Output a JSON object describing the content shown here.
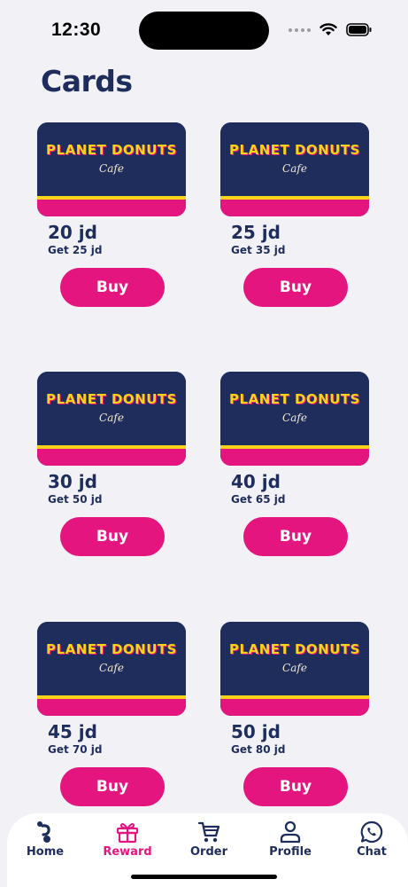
{
  "status_bar": {
    "time": "12:30"
  },
  "page": {
    "title": "Cards"
  },
  "card_logo": {
    "line1": "PLANET DONUTS",
    "line2": "Cafe"
  },
  "cards": [
    {
      "price": "20 jd",
      "bonus": "Get 25 jd",
      "buy_label": "Buy"
    },
    {
      "price": "25 jd",
      "bonus": "Get 35 jd",
      "buy_label": "Buy"
    },
    {
      "price": "30 jd",
      "bonus": "Get 50 jd",
      "buy_label": "Buy"
    },
    {
      "price": "40 jd",
      "bonus": "Get 65 jd",
      "buy_label": "Buy"
    },
    {
      "price": "45 jd",
      "bonus": "Get 70 jd",
      "buy_label": "Buy"
    },
    {
      "price": "50 jd",
      "bonus": "Get 80 jd",
      "buy_label": "Buy"
    }
  ],
  "nav": {
    "items": [
      {
        "label": "Home",
        "icon": "home-logo-icon"
      },
      {
        "label": "Reward",
        "icon": "gift-icon",
        "active": true
      },
      {
        "label": "Order",
        "icon": "cart-icon"
      },
      {
        "label": "Profile",
        "icon": "person-icon"
      },
      {
        "label": "Chat",
        "icon": "whatsapp-icon"
      }
    ]
  },
  "colors": {
    "brand_navy": "#1f2d5c",
    "brand_pink": "#e5157f",
    "brand_yellow": "#f7d31a",
    "background": "#f2f1f6"
  }
}
